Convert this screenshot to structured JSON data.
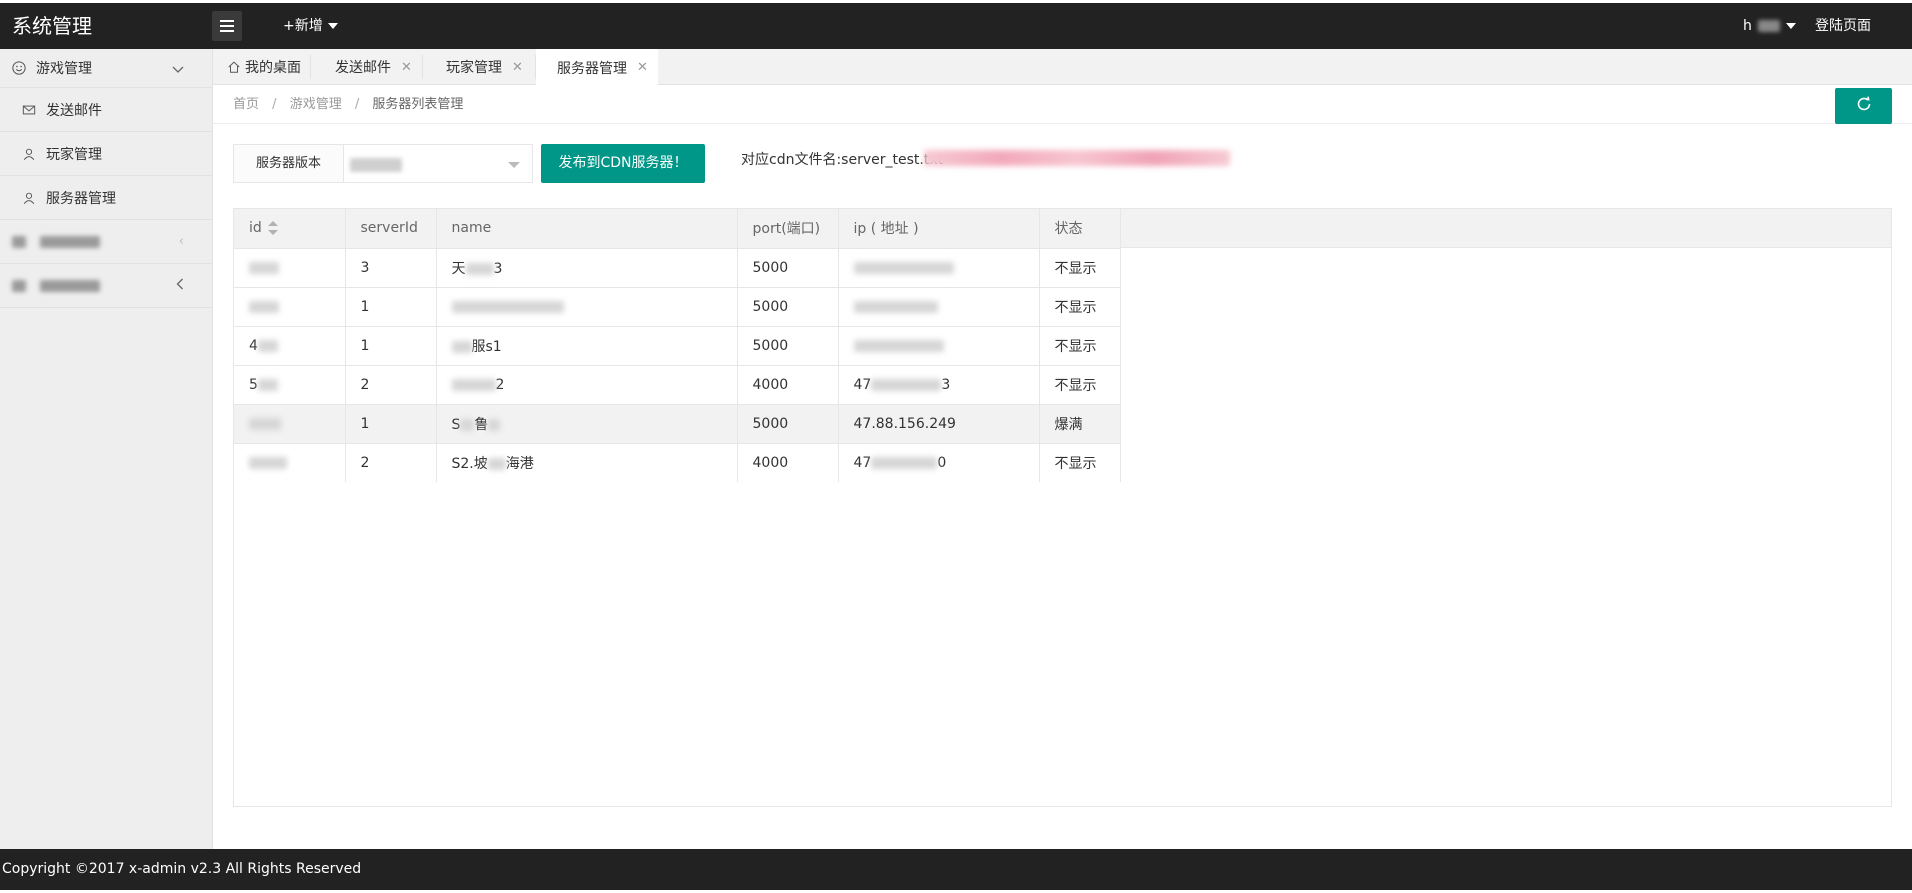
{
  "header": {
    "logo": "系统管理",
    "add_new": "+新增",
    "user_name": "h",
    "login_page": "登陆页面"
  },
  "sidebar": {
    "groups": [
      {
        "label": "游戏管理",
        "icon": "smile-icon",
        "expanded": true,
        "items": [
          {
            "label": "发送邮件",
            "icon": "mail-icon"
          },
          {
            "label": "玩家管理",
            "icon": "user-icon"
          },
          {
            "label": "服务器管理",
            "icon": "user-icon"
          }
        ]
      }
    ]
  },
  "tabs": [
    {
      "label": "我的桌面",
      "icon": "home-icon",
      "closable": false,
      "active": false
    },
    {
      "label": "发送邮件",
      "closable": true,
      "active": false
    },
    {
      "label": "玩家管理",
      "closable": true,
      "active": false
    },
    {
      "label": "服务器管理",
      "closable": true,
      "active": true
    }
  ],
  "breadcrumb": {
    "home": "首页",
    "section": "游戏管理",
    "current": "服务器列表管理"
  },
  "toolbar": {
    "version_label": "服务器版本",
    "publish_button": "发布到CDN服务器！",
    "cdn_text": "对应cdn文件名:server_test.txt"
  },
  "table": {
    "columns": [
      "id",
      "serverId",
      "name",
      "port(端口)",
      "ip ( 地址 )",
      "状态"
    ],
    "rows": [
      {
        "id": "",
        "serverId": "3",
        "name": "天",
        "name_suffix": "3",
        "port": "5000",
        "ip": "",
        "status": "不显示"
      },
      {
        "id": "",
        "serverId": "1",
        "name": "",
        "name_suffix": "",
        "port": "5000",
        "ip": "",
        "status": "不显示"
      },
      {
        "id": "4",
        "serverId": "1",
        "name": "",
        "name_suffix": "服s1",
        "port": "5000",
        "ip": "",
        "status": "不显示"
      },
      {
        "id": "5",
        "serverId": "2",
        "name": "",
        "name_suffix": "2",
        "port": "4000",
        "ip": "47",
        "ip_suffix": "3",
        "status": "不显示"
      },
      {
        "id": "",
        "serverId": "1",
        "name": "S",
        "name_suffix": "鲁",
        "port": "5000",
        "ip": "47.88.156.249",
        "status": "爆满"
      },
      {
        "id": "",
        "serverId": "2",
        "name": "S2.坡",
        "name_suffix": "海港",
        "port": "4000",
        "ip": "47",
        "ip_suffix": "0",
        "status": "不显示"
      }
    ]
  },
  "footer": {
    "copyright": "Copyright ©2017 x-admin v2.3 All Rights Reserved"
  },
  "colors": {
    "header_bg": "#222222",
    "accent": "#009688",
    "status_full": "#d9a12b"
  }
}
